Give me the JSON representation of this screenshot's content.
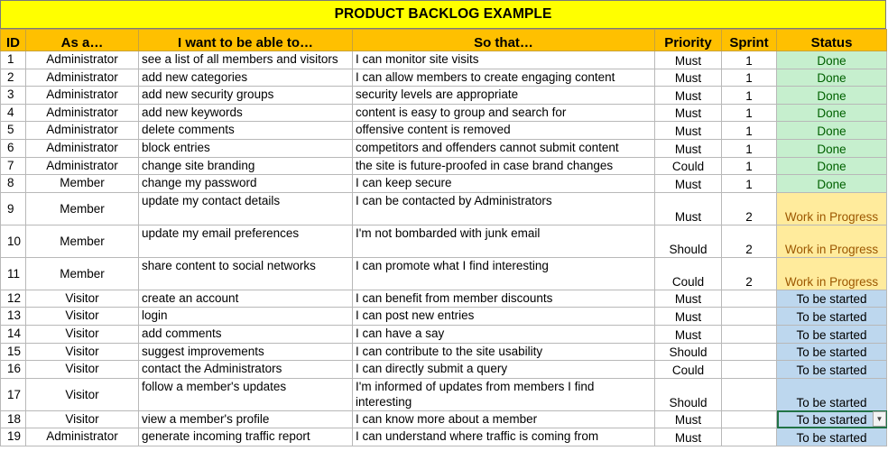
{
  "title": "PRODUCT BACKLOG EXAMPLE",
  "headers": {
    "id": "ID",
    "as_a": "As a…",
    "want": "I want to be able to…",
    "so_that": "So that…",
    "priority": "Priority",
    "sprint": "Sprint",
    "status": "Status"
  },
  "rows": [
    {
      "id": "1",
      "role": "Administrator",
      "want": "see a list of all members and visitors",
      "so_that": "I can monitor site visits",
      "priority": "Must",
      "sprint": "1",
      "status": "Done"
    },
    {
      "id": "2",
      "role": "Administrator",
      "want": "add new categories",
      "so_that": "I can allow members to create engaging content",
      "priority": "Must",
      "sprint": "1",
      "status": "Done"
    },
    {
      "id": "3",
      "role": "Administrator",
      "want": "add new security groups",
      "so_that": "security levels are appropriate",
      "priority": "Must",
      "sprint": "1",
      "status": "Done"
    },
    {
      "id": "4",
      "role": "Administrator",
      "want": "add new keywords",
      "so_that": "content is easy to group and search for",
      "priority": "Must",
      "sprint": "1",
      "status": "Done"
    },
    {
      "id": "5",
      "role": "Administrator",
      "want": "delete comments",
      "so_that": "offensive content is removed",
      "priority": "Must",
      "sprint": "1",
      "status": "Done"
    },
    {
      "id": "6",
      "role": "Administrator",
      "want": "block entries",
      "so_that": "competitors and offenders cannot submit content",
      "priority": "Must",
      "sprint": "1",
      "status": "Done"
    },
    {
      "id": "7",
      "role": "Administrator",
      "want": "change site branding",
      "so_that": "the site is future-proofed in case brand changes",
      "priority": "Could",
      "sprint": "1",
      "status": "Done"
    },
    {
      "id": "8",
      "role": "Member",
      "want": "change my password",
      "so_that": "I can keep secure",
      "priority": "Must",
      "sprint": "1",
      "status": "Done"
    },
    {
      "id": "9",
      "role": "Member",
      "want": "update my contact details",
      "so_that": "I can be contacted by Administrators",
      "priority": "Must",
      "sprint": "2",
      "status": "Work in Progress"
    },
    {
      "id": "10",
      "role": "Member",
      "want": "update my email preferences",
      "so_that": "I'm not bombarded with junk email",
      "priority": "Should",
      "sprint": "2",
      "status": "Work in Progress"
    },
    {
      "id": "11",
      "role": "Member",
      "want": "share content to social networks",
      "so_that": "I can promote what I find interesting",
      "priority": "Could",
      "sprint": "2",
      "status": "Work in Progress"
    },
    {
      "id": "12",
      "role": "Visitor",
      "want": "create an account",
      "so_that": "I can benefit from member discounts",
      "priority": "Must",
      "sprint": "",
      "status": "To be started"
    },
    {
      "id": "13",
      "role": "Visitor",
      "want": "login",
      "so_that": "I can post new entries",
      "priority": "Must",
      "sprint": "",
      "status": "To be started"
    },
    {
      "id": "14",
      "role": "Visitor",
      "want": "add comments",
      "so_that": "I can have a say",
      "priority": "Must",
      "sprint": "",
      "status": "To be started"
    },
    {
      "id": "15",
      "role": "Visitor",
      "want": "suggest improvements",
      "so_that": "I can contribute to the site usability",
      "priority": "Should",
      "sprint": "",
      "status": "To be started"
    },
    {
      "id": "16",
      "role": "Visitor",
      "want": "contact the Administrators",
      "so_that": "I can directly submit a query",
      "priority": "Could",
      "sprint": "",
      "status": "To be started"
    },
    {
      "id": "17",
      "role": "Visitor",
      "want": "follow a member's updates",
      "so_that": "I'm informed of updates from members I find interesting",
      "priority": "Should",
      "sprint": "",
      "status": "To be started"
    },
    {
      "id": "18",
      "role": "Visitor",
      "want": "view a  member's profile",
      "so_that": "I can know more about a member",
      "priority": "Must",
      "sprint": "",
      "status": "To be started"
    },
    {
      "id": "19",
      "role": "Administrator",
      "want": "generate incoming traffic report",
      "so_that": "I can understand where traffic is coming from",
      "priority": "Must",
      "sprint": "",
      "status": "To be started"
    }
  ],
  "status_colors": {
    "Done": "#c6efce",
    "Work in Progress": "#ffeb9c",
    "To be started": "#bdd7ee"
  }
}
